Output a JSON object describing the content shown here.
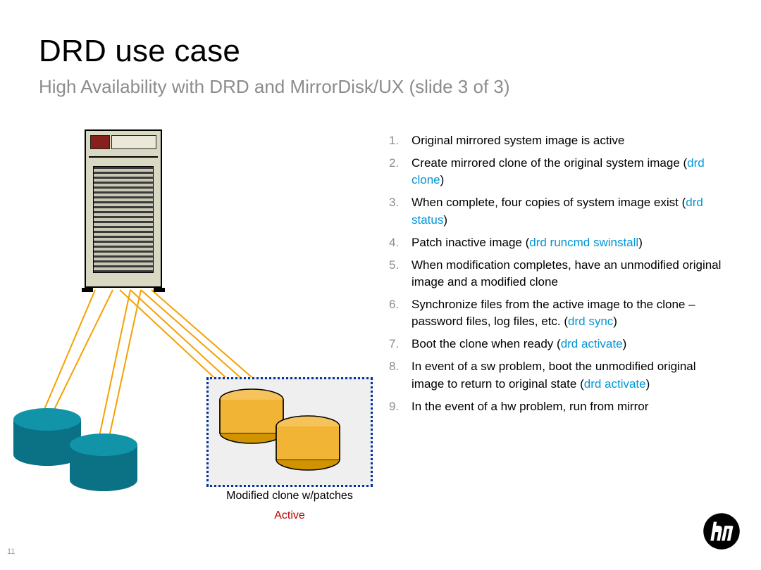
{
  "title": "DRD use case",
  "subtitle": "High Availability with DRD and MirrorDisk/UX (slide 3 of 3)",
  "page": "11",
  "clone_label": "Modified clone w/patches",
  "active_label": "Active",
  "steps": [
    {
      "pre": "Original mirrored system image is active",
      "cmd": "",
      "post": ""
    },
    {
      "pre": "Create mirrored clone of the original system image (",
      "cmd": "drd clone",
      "post": ")"
    },
    {
      "pre": "When complete, four copies of system image exist (",
      "cmd": "drd status",
      "post": ")"
    },
    {
      "pre": "Patch inactive image (",
      "cmd": "drd runcmd swinstall",
      "post": ")"
    },
    {
      "pre": "When modification completes, have an unmodified original image and a modified clone",
      "cmd": "",
      "post": ""
    },
    {
      "pre": "Synchronize files from the active image to the clone – password files, log files, etc. (",
      "cmd": "drd sync",
      "post": ")"
    },
    {
      "pre": "Boot the clone when ready (",
      "cmd": "drd activate",
      "post": ")"
    },
    {
      "pre": "In event of a sw problem, boot the unmodified original image to return to original state (",
      "cmd": "drd activate",
      "post": ")"
    },
    {
      "pre": "In the event of a hw problem, run from mirror",
      "cmd": "",
      "post": ""
    }
  ]
}
